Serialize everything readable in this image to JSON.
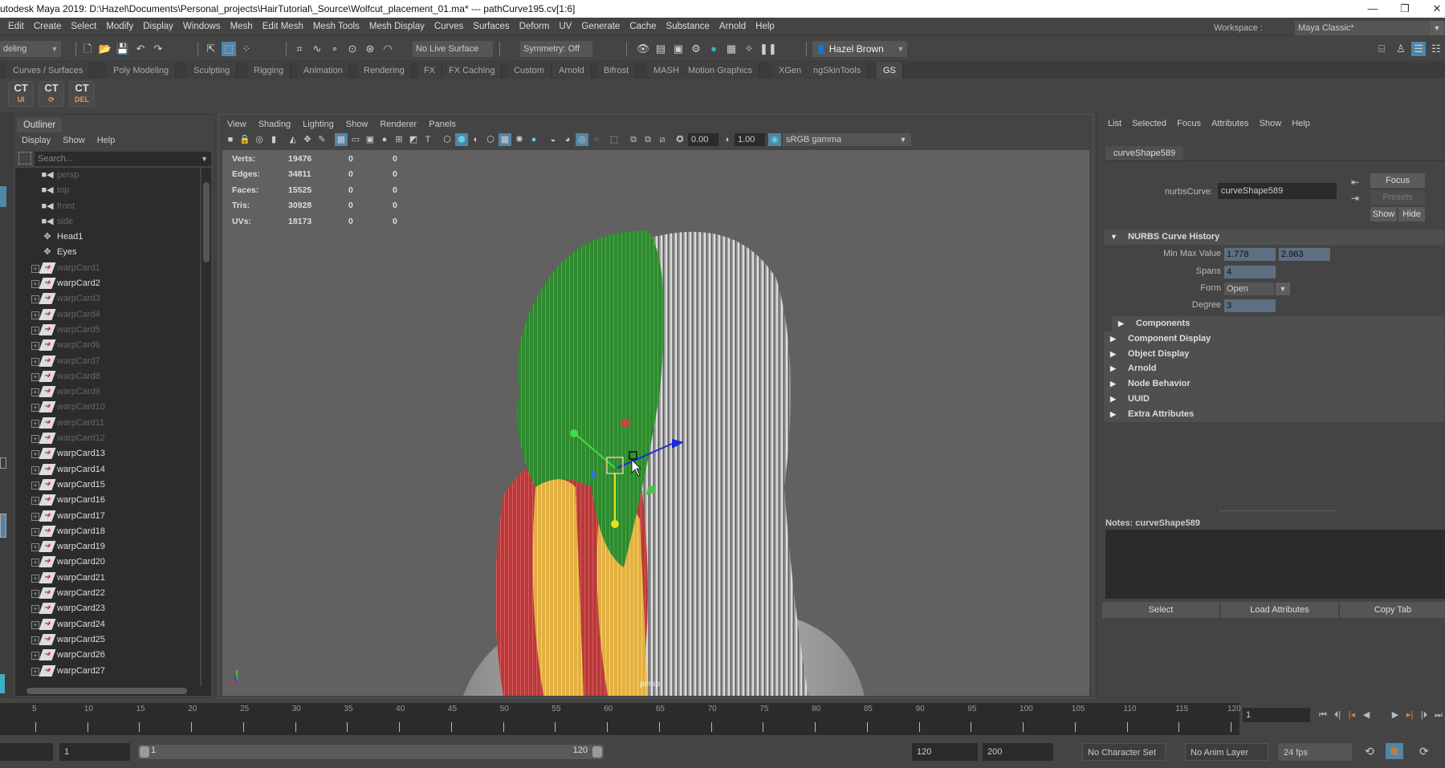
{
  "window": {
    "title": "utodesk Maya 2019: D:\\Hazel\\Documents\\Personal_projects\\HairTutorial\\_Source\\Wolfcut_placement_01.ma*  ---  pathCurve195.cv[1:6]",
    "controls": {
      "minimize": "—",
      "restore": "❐",
      "close": "✕"
    }
  },
  "menubar": [
    "Edit",
    "Create",
    "Select",
    "Modify",
    "Display",
    "Windows",
    "Mesh",
    "Edit Mesh",
    "Mesh Tools",
    "Mesh Display",
    "Curves",
    "Surfaces",
    "Deform",
    "UV",
    "Generate",
    "Cache",
    "Substance",
    "Arnold",
    "Help"
  ],
  "workspace": {
    "label": "Workspace :",
    "value": "Maya Classic*"
  },
  "statusline": {
    "menuset": "deling",
    "live_surface": "No Live Surface",
    "symmetry": "Symmetry: Off",
    "user": "Hazel Brown"
  },
  "shelf_tabs": [
    "Curves / Surfaces",
    "Poly Modeling",
    "Sculpting",
    "Rigging",
    "Animation",
    "Rendering",
    "FX",
    "FX Caching",
    "Custom",
    "Arnold",
    "Bifrost",
    "MASH",
    "Motion Graphics",
    "XGen",
    "ngSkinTools",
    "GS"
  ],
  "shelf_active": "GS",
  "shelf_icons": [
    {
      "name": "CT",
      "sub": "UI"
    },
    {
      "name": "CT",
      "sub": "⟳"
    },
    {
      "name": "CT",
      "sub": "DEL"
    }
  ],
  "outliner": {
    "tab": "Outliner",
    "menu": [
      "Display",
      "Show",
      "Help"
    ],
    "search_placeholder": "Search...",
    "items": [
      {
        "label": "persp",
        "type": "camera",
        "dim": true
      },
      {
        "label": "top",
        "type": "camera",
        "dim": true
      },
      {
        "label": "front",
        "type": "camera",
        "dim": true
      },
      {
        "label": "side",
        "type": "camera",
        "dim": true
      },
      {
        "label": "Head1",
        "type": "group",
        "dim": false
      },
      {
        "label": "Eyes",
        "type": "group",
        "dim": false
      },
      {
        "label": "warpCard1",
        "type": "card",
        "dim": true
      },
      {
        "label": "warpCard2",
        "type": "card",
        "dim": false
      },
      {
        "label": "warpCard3",
        "type": "card",
        "dim": true
      },
      {
        "label": "warpCard4",
        "type": "card",
        "dim": true
      },
      {
        "label": "warpCard5",
        "type": "card",
        "dim": true
      },
      {
        "label": "warpCard6",
        "type": "card",
        "dim": true
      },
      {
        "label": "warpCard7",
        "type": "card",
        "dim": true
      },
      {
        "label": "warpCard8",
        "type": "card",
        "dim": true
      },
      {
        "label": "warpCard9",
        "type": "card",
        "dim": true
      },
      {
        "label": "warpCard10",
        "type": "card",
        "dim": true
      },
      {
        "label": "warpCard11",
        "type": "card",
        "dim": true
      },
      {
        "label": "warpCard12",
        "type": "card",
        "dim": true
      },
      {
        "label": "warpCard13",
        "type": "card",
        "dim": false
      },
      {
        "label": "warpCard14",
        "type": "card",
        "dim": false
      },
      {
        "label": "warpCard15",
        "type": "card",
        "dim": false
      },
      {
        "label": "warpCard16",
        "type": "card",
        "dim": false
      },
      {
        "label": "warpCard17",
        "type": "card",
        "dim": false
      },
      {
        "label": "warpCard18",
        "type": "card",
        "dim": false
      },
      {
        "label": "warpCard19",
        "type": "card",
        "dim": false
      },
      {
        "label": "warpCard20",
        "type": "card",
        "dim": false
      },
      {
        "label": "warpCard21",
        "type": "card",
        "dim": false
      },
      {
        "label": "warpCard22",
        "type": "card",
        "dim": false
      },
      {
        "label": "warpCard23",
        "type": "card",
        "dim": false
      },
      {
        "label": "warpCard24",
        "type": "card",
        "dim": false
      },
      {
        "label": "warpCard25",
        "type": "card",
        "dim": false
      },
      {
        "label": "warpCard26",
        "type": "card",
        "dim": false
      },
      {
        "label": "warpCard27",
        "type": "card",
        "dim": false
      }
    ]
  },
  "viewport": {
    "menu": [
      "View",
      "Shading",
      "Lighting",
      "Show",
      "Renderer",
      "Panels"
    ],
    "exposure": "0.00",
    "gamma": "1.00",
    "color_space": "sRGB gamma",
    "camera": "persp",
    "hud": [
      {
        "label": "Verts:",
        "a": "19476",
        "b": "0",
        "c": "0"
      },
      {
        "label": "Edges:",
        "a": "34811",
        "b": "0",
        "c": "0"
      },
      {
        "label": "Faces:",
        "a": "15525",
        "b": "0",
        "c": "0"
      },
      {
        "label": "Tris:",
        "a": "30928",
        "b": "0",
        "c": "0"
      },
      {
        "label": "UVs:",
        "a": "18173",
        "b": "0",
        "c": "0"
      }
    ],
    "hair_colors": {
      "green": "#2e8b2e",
      "red": "#b83a3a",
      "yellow": "#e2b040",
      "gray": "#8a8a8a",
      "bg": "#616161"
    }
  },
  "attribute_editor": {
    "menu": [
      "List",
      "Selected",
      "Focus",
      "Attributes",
      "Show",
      "Help"
    ],
    "tab": "curveShape589",
    "node_type_label": "nurbsCurve:",
    "node_name": "curveShape589",
    "buttons": {
      "focus": "Focus",
      "presets": "Presets",
      "show": "Show",
      "hide": "Hide"
    },
    "section_history": "NURBS Curve History",
    "fields": {
      "min_max_label": "Min Max Value",
      "min": "1.778",
      "max": "2.963",
      "spans_label": "Spans",
      "spans": "4",
      "form_label": "Form",
      "form": "Open",
      "degree_label": "Degree",
      "degree": "3"
    },
    "sections": [
      "Components",
      "Component Display",
      "Object Display",
      "Arnold",
      "Node Behavior",
      "UUID",
      "Extra Attributes"
    ],
    "notes_label": "Notes:  curveShape589",
    "bottom_buttons": [
      "Select",
      "Load Attributes",
      "Copy Tab"
    ]
  },
  "timeline": {
    "ticks": [
      "5",
      "10",
      "15",
      "20",
      "25",
      "30",
      "35",
      "40",
      "45",
      "50",
      "55",
      "60",
      "65",
      "70",
      "75",
      "80",
      "85",
      "90",
      "95",
      "100",
      "105",
      "110",
      "115",
      "120"
    ],
    "current_frame": "1",
    "range_start": "1",
    "range_inner_start": "1",
    "range_inner_end": "120",
    "range_end": "120",
    "anim_end": "200",
    "character_set": "No Character Set",
    "anim_layer": "No Anim Layer",
    "fps": "24 fps"
  }
}
